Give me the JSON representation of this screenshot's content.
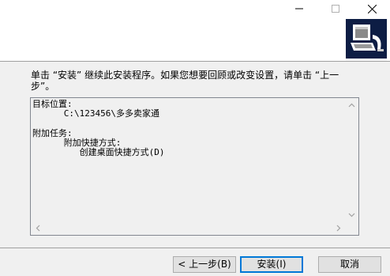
{
  "window": {
    "controls": {
      "minimize": "minimize-icon",
      "maximize": "maximize-icon",
      "close": "close-icon"
    }
  },
  "header": {
    "logo_icon": "installer-computer-icon"
  },
  "instruction": "单击 “安装” 继续此安装程序。如果您想要回顾或改变设置，请单击 “上一步”。",
  "memo": {
    "lines": [
      "目标位置:",
      "      C:\\123456\\多多卖家通",
      "",
      "附加任务:",
      "      附加快捷方式:",
      "         创建桌面快捷方式(D)"
    ]
  },
  "buttons": {
    "back": "< 上一步(B)",
    "install": "安装(I)",
    "cancel": "取消"
  }
}
